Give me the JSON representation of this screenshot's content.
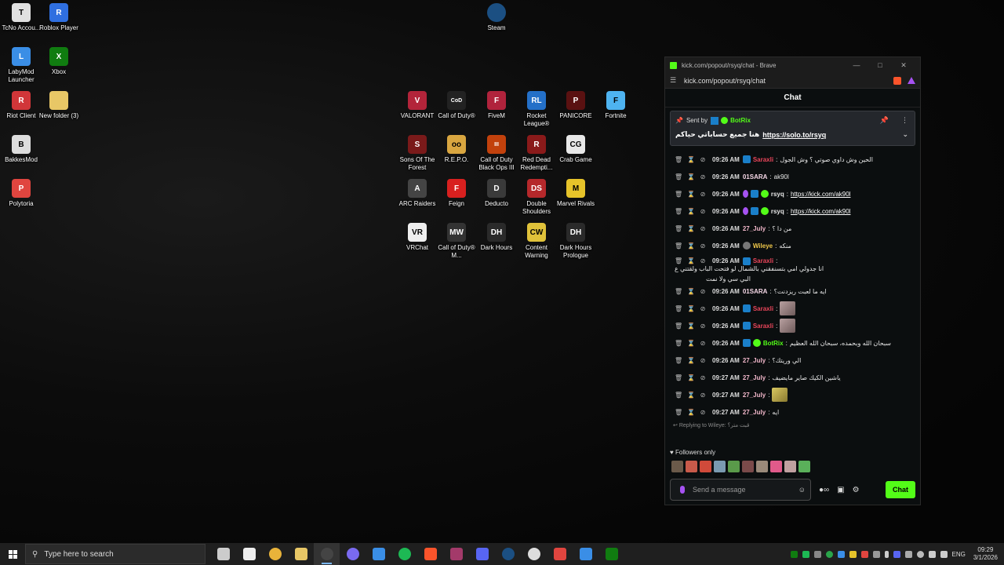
{
  "desktop": {
    "left_icons": [
      {
        "name": "tcno-icon",
        "label": "TcNo Accou...",
        "color": "#e0e0e0",
        "glyph": "T"
      },
      {
        "name": "roblox-icon",
        "label": "Roblox Player",
        "color": "#2f6fe0",
        "glyph": "R"
      },
      {
        "name": "labymod-icon",
        "label": "LabyMod Launcher",
        "color": "#3a8ee6",
        "glyph": "L"
      },
      {
        "name": "xbox-icon",
        "label": "Xbox",
        "color": "#107c10",
        "glyph": "X"
      },
      {
        "name": "riot-client-icon",
        "label": "Riot Client",
        "color": "#d13639",
        "glyph": "R"
      },
      {
        "name": "folder-icon",
        "label": "New folder (3)",
        "color": "#e8c766",
        "glyph": ""
      },
      {
        "name": "bakkesmod-icon",
        "label": "BakkesMod",
        "color": "#dddddd",
        "glyph": "B"
      },
      {
        "name": "polytoria-icon",
        "label": "Polytoria",
        "color": "#e0453f",
        "glyph": "P"
      }
    ],
    "steam_icon": {
      "label": "Steam",
      "color": "#1b4f82"
    },
    "game_icons": [
      {
        "name": "valorant-icon",
        "label": "VALORANT",
        "color": "#b3243a",
        "glyph": "V"
      },
      {
        "name": "cod-icon",
        "label": "Call of Duty®",
        "color": "#222222",
        "glyph": "CoD"
      },
      {
        "name": "fivem-icon",
        "label": "FiveM",
        "color": "#b0233c",
        "glyph": "F"
      },
      {
        "name": "rocket-league-icon",
        "label": "Rocket League®",
        "color": "#2470c8",
        "glyph": "RL"
      },
      {
        "name": "panicore-icon",
        "label": "PANICORE",
        "color": "#5a1111",
        "glyph": "P"
      },
      {
        "name": "fortnite-icon",
        "label": "Fortnite",
        "color": "#4eb3f0",
        "glyph": "F"
      },
      {
        "name": "sons-of-the-forest-icon",
        "label": "Sons Of The Forest",
        "color": "#7a1a1a",
        "glyph": "S"
      },
      {
        "name": "repo-icon",
        "label": "R.E.P.O.",
        "color": "#d9a640",
        "glyph": "oo"
      },
      {
        "name": "cod-bo3-icon",
        "label": "Call of Duty Black Ops III",
        "color": "#c2410c",
        "glyph": "III"
      },
      {
        "name": "red-dead-icon",
        "label": "Red Dead Redempti...",
        "color": "#8a1a1a",
        "glyph": "R"
      },
      {
        "name": "crab-game-icon",
        "label": "Crab Game",
        "color": "#e8e8e8",
        "glyph": "CG"
      },
      {
        "name": "arc-raiders-icon",
        "label": "ARC Raiders",
        "color": "#444444",
        "glyph": "A"
      },
      {
        "name": "feign-icon",
        "label": "Feign",
        "color": "#d8201f",
        "glyph": "F"
      },
      {
        "name": "deducto-icon",
        "label": "Deducto",
        "color": "#3a3a3a",
        "glyph": "D"
      },
      {
        "name": "double-shoulders-icon",
        "label": "Double Shoulders",
        "color": "#b5282b",
        "glyph": "DS"
      },
      {
        "name": "marvel-rivals-icon",
        "label": "Marvel Rivals",
        "color": "#e6c32a",
        "glyph": "M"
      },
      {
        "name": "vrchat-icon",
        "label": "VRChat",
        "color": "#eeeeee",
        "glyph": "VR"
      },
      {
        "name": "cod-mw-icon",
        "label": "Call of Duty® M...",
        "color": "#333333",
        "glyph": "MW"
      },
      {
        "name": "dark-hours-icon",
        "label": "Dark Hours",
        "color": "#2a2a2a",
        "glyph": "DH"
      },
      {
        "name": "content-warning-icon",
        "label": "Content Warning",
        "color": "#e0c23a",
        "glyph": "CW"
      },
      {
        "name": "dark-hours-prologue-icon",
        "label": "Dark Hours Prologue",
        "color": "#2a2a2a",
        "glyph": "DH"
      }
    ]
  },
  "browser": {
    "title": "kick.com/popout/rsyq/chat - Brave",
    "url": "kick.com/popout/rsyq/chat",
    "chat_title": "Chat",
    "pinned": {
      "sent_by": "Sent by",
      "user": "BotRix",
      "text": "هنا جميع حساباتي حياكم",
      "link": "https://solo.to/rsyq"
    },
    "messages": [
      {
        "time": "09:26 AM",
        "user": "Saraxli",
        "color": "#e9455a",
        "badges": [
          "blue"
        ],
        "text": "الحين وش داوي صوتي ؟ وش الجول"
      },
      {
        "reply": "Replying to Wileye: قبت متر؟"
      },
      {
        "time": "09:26 AM",
        "user": "01SARA",
        "color": "#f5d7e6",
        "badges": [],
        "text": "ak90l"
      },
      {
        "time": "09:26 AM",
        "user": "rsyq",
        "color": "#e8e8e8",
        "badges": [
          "purple",
          "blue",
          "green"
        ],
        "link": "https://kick.com/ak90l"
      },
      {
        "time": "09:26 AM",
        "user": "rsyq",
        "color": "#e8e8e8",
        "badges": [
          "purple",
          "blue",
          "green"
        ],
        "link": "https://kick.com/ak90l"
      },
      {
        "time": "09:26 AM",
        "user": "27_July",
        "color": "#f0b6c9",
        "badges": [],
        "text": "من دا ؟"
      },
      {
        "time": "09:26 AM",
        "user": "Wileye",
        "color": "#f0c84a",
        "badges": [
          "gray"
        ],
        "text": "منكه"
      },
      {
        "time": "09:26 AM",
        "user": "Saraxli",
        "color": "#e9455a",
        "badges": [
          "blue"
        ],
        "text": "انا جدولي امي بتسنفقني بالشمال لو فتحت الباب ولقتني ع",
        "wrap": "البي سي ولا نمت",
        "tall": true
      },
      {
        "time": "09:26 AM",
        "user": "01SARA",
        "color": "#f5d7e6",
        "badges": [],
        "text": "ايه ما لعبت ريزدنت؟"
      },
      {
        "time": "09:26 AM",
        "user": "Saraxli",
        "color": "#e9455a",
        "badges": [
          "blue"
        ],
        "emote": "pink"
      },
      {
        "time": "09:26 AM",
        "user": "Saraxli",
        "color": "#e9455a",
        "badges": [
          "blue"
        ],
        "emote": "pink"
      },
      {
        "time": "09:26 AM",
        "user": "BotRix",
        "color": "#53fc18",
        "badges": [
          "blue",
          "green"
        ],
        "text": "سبحان الله وبحمده، سبحان الله العظيم"
      },
      {
        "time": "09:26 AM",
        "user": "27_July",
        "color": "#f0b6c9",
        "badges": [],
        "text": "الي وريتك؟"
      },
      {
        "time": "09:27 AM",
        "user": "27_July",
        "color": "#f0b6c9",
        "badges": [],
        "text": "ياشين الكيك صاير مايضيف"
      },
      {
        "time": "09:27 AM",
        "user": "27_July",
        "color": "#f0b6c9",
        "badges": [],
        "emote": "yellow"
      },
      {
        "time": "09:27 AM",
        "user": "27_July",
        "color": "#f0b6c9",
        "badges": [],
        "text": "ايه"
      }
    ],
    "followers_label": "Followers only",
    "emote_colors": [
      "#6b5a4a",
      "#c85a4a",
      "#d04a3a",
      "#7a9ab0",
      "#5a9a4a",
      "#7a4a4a",
      "#9a8a7a",
      "#e05a8a",
      "#c0a0a0",
      "#5ab05a"
    ],
    "input_placeholder": "Send a message",
    "send_label": "Chat"
  },
  "taskbar": {
    "search_placeholder": "Type here to search",
    "apps": [
      {
        "name": "task-view-icon",
        "color": "#cccccc"
      },
      {
        "name": "steelseries-icon",
        "color": "#eeeeee"
      },
      {
        "name": "chrome-icon",
        "color": "#e8b33a"
      },
      {
        "name": "file-explorer-icon",
        "color": "#e8c766"
      },
      {
        "name": "obs-icon",
        "color": "#444444",
        "active": true
      },
      {
        "name": "discord-ptb-icon",
        "color": "#7a6af0"
      },
      {
        "name": "app-blue-icon",
        "color": "#3a8ee6"
      },
      {
        "name": "spotify-icon",
        "color": "#1db954"
      },
      {
        "name": "brave-icon",
        "color": "#fb542b"
      },
      {
        "name": "winrar-icon",
        "color": "#a33a6a"
      },
      {
        "name": "discord-icon",
        "color": "#5865f2"
      },
      {
        "name": "steam-icon",
        "color": "#1b4f82"
      },
      {
        "name": "g-hub-icon",
        "color": "#dddddd"
      },
      {
        "name": "brave-nightly-icon",
        "color": "#e0453f"
      },
      {
        "name": "store-icon",
        "color": "#3a8ee6"
      },
      {
        "name": "xbox-icon",
        "color": "#107c10"
      }
    ],
    "lang": "ENG",
    "time": "09:29",
    "date": "3/1/2026"
  }
}
